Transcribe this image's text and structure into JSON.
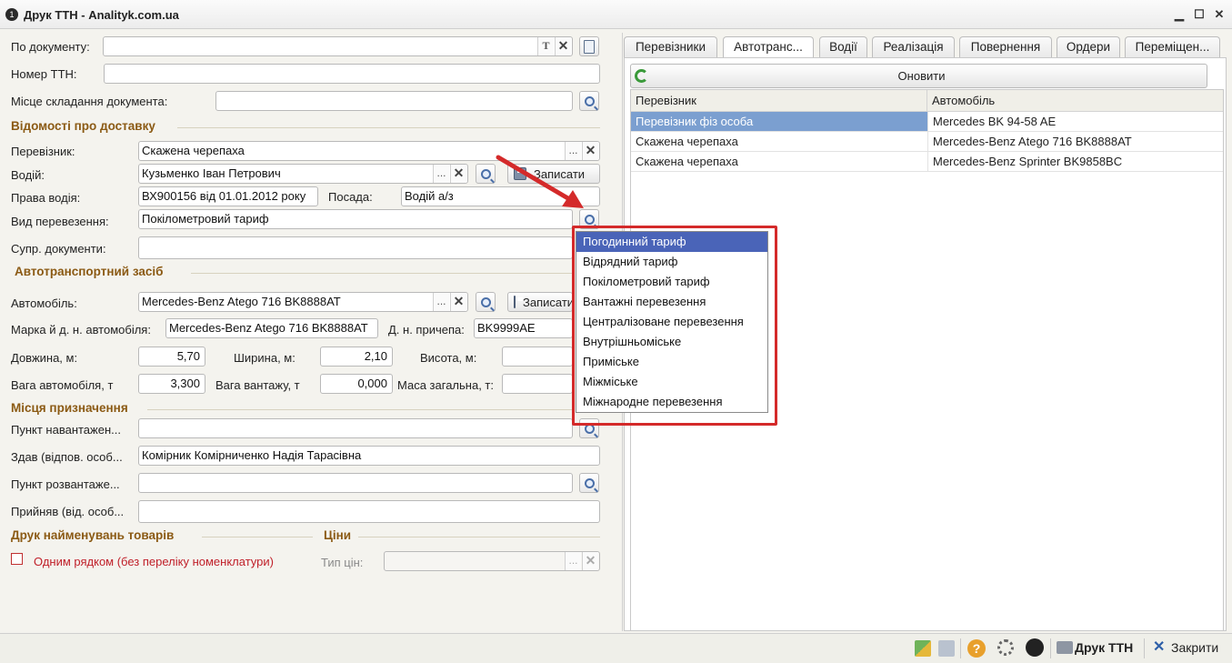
{
  "window": {
    "title": "Друк ТТН - Analityk.com.ua",
    "controls": {
      "minimize": "▁",
      "maximize": "☐",
      "close": "✕"
    }
  },
  "form": {
    "doc_label": "По документу:",
    "ttn_label": "Номер ТТН:",
    "place_label": "Місце складання документа:",
    "delivery_section": "Відомості про доставку",
    "carrier_label": "Перевізник:",
    "carrier_value": "Скажена черепаха",
    "driver_label": "Водій:",
    "driver_value": "Кузьменко Іван Петрович",
    "save_label": "Записати",
    "license_label": "Права водія:",
    "license_value": "ВХ900156 від 01.01.2012 року",
    "position_label": "Посада:",
    "position_value": "Водій а/з",
    "transport_type_label": "Вид перевезення:",
    "transport_type_value": "Покілометровий тариф",
    "accomp_docs_label": "Супр. документи:",
    "vehicle_section": "Автотранспортний засіб",
    "car_label": "Автомобіль:",
    "car_value": "Mercedes-Benz Atego 716 BK8888AT",
    "car_save_label": "Записати",
    "brand_label": "Марка й д. н. автомобіля:",
    "brand_value": "Mercedes-Benz Atego 716 BK8888AT",
    "trailer_label": "Д. н. причепа:",
    "trailer_value": "BK9999AE",
    "length_label": "Довжина, м:",
    "length_value": "5,70",
    "width_label": "Ширина, м:",
    "width_value": "2,10",
    "height_label": "Висота, м:",
    "car_weight_label": "Вага автомобіля, т",
    "car_weight_value": "3,300",
    "cargo_weight_label": "Вага вантажу, т",
    "cargo_weight_value": "0,000",
    "total_weight_label": "Маса загальна, т:",
    "dest_section": "Місця призначення",
    "load_point_label": "Пункт навантажен...",
    "handed_label": "Здав (відпов. особ...",
    "handed_value": "Комірник Комірниченко Надія Тарасівна",
    "unload_point_label": "Пункт розвантаже...",
    "received_label": "Прийняв (від. особ...",
    "print_section": "Друк найменувань товарів",
    "prices_section": "Ціни",
    "single_row_label": "Одним рядком (без переліку номенклатури)",
    "price_type_label": "Тип цін:",
    "btn_dots": "...",
    "btn_x": "✕",
    "btn_t": "T"
  },
  "tabs": [
    "Перевізники",
    "Автотранс...",
    "Водії",
    "Реалізація",
    "Повернення",
    "Ордери",
    "Переміщен..."
  ],
  "right": {
    "refresh_label": "Оновити",
    "columns": [
      "Перевізник",
      "Автомобіль"
    ],
    "rows": [
      {
        "carrier": "Перевізник фіз особа",
        "car": "Mercedes BK 94-58 AE"
      },
      {
        "carrier": "Скажена черепаха",
        "car": "Mercedes-Benz Atego 716 BK8888AT"
      },
      {
        "carrier": "Скажена черепаха",
        "car": "Mercedes-Benz Sprinter BK9858BC"
      }
    ]
  },
  "dropdown": {
    "items": [
      "Погодинний тариф",
      "Відрядний тариф",
      "Покілометровий тариф",
      "Вантажні перевезення",
      "Централізоване перевезення",
      "Внутрішньоміське",
      "Приміське",
      "Міжміське",
      "Міжнародне перевезення"
    ]
  },
  "statusbar": {
    "print_label": "Друк ТТН",
    "close_label": "Закрити",
    "help_glyph": "?"
  },
  "colors": {
    "accent_section": "#8b5a14",
    "selection": "#4a64b8",
    "highlight_box": "#d42a2a"
  }
}
